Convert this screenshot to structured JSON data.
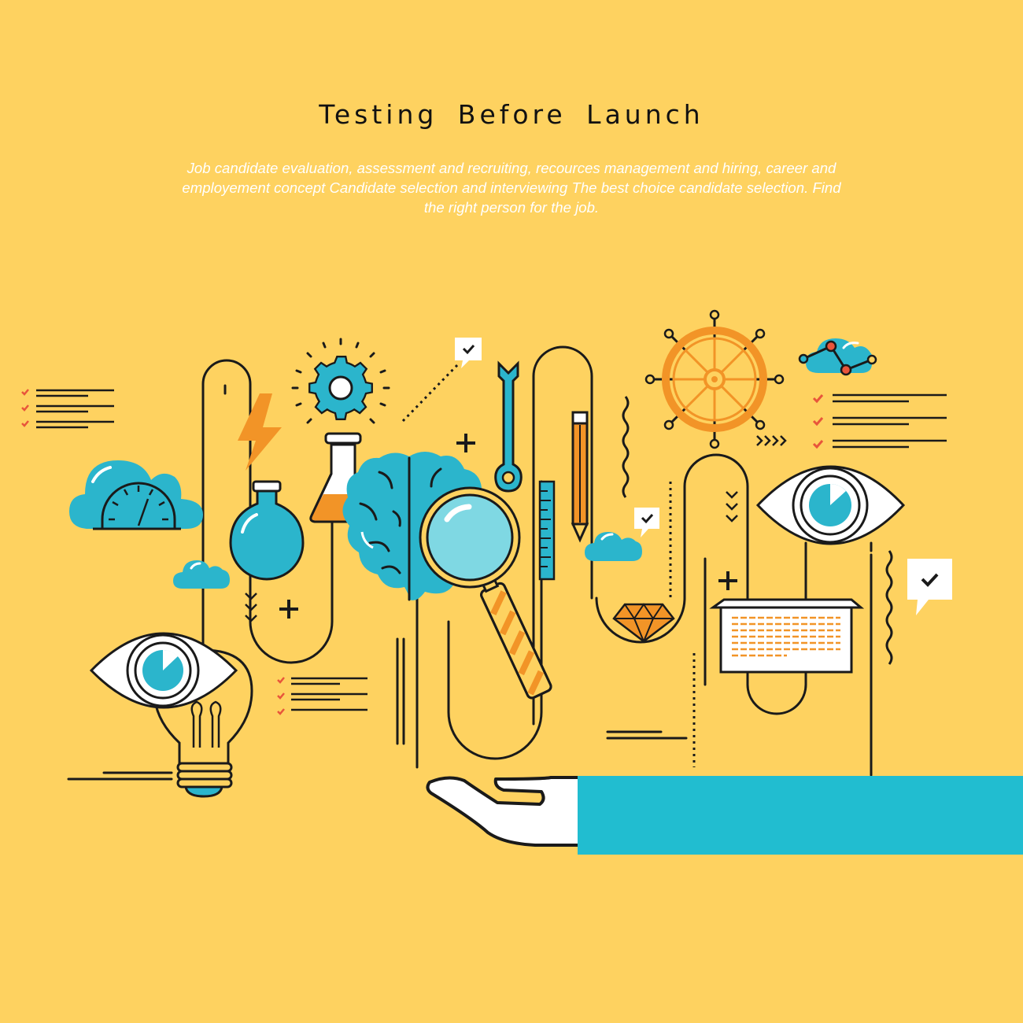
{
  "header": {
    "title": "Testing Before Launch",
    "subtitle": "Job candidate evaluation, assessment and recruiting, recources management and hiring, career and employement concept  Candidate selection and interviewing  The best choice candidate selection. Find the right person for the job."
  },
  "colors": {
    "background": "#fed260",
    "line": "#1a1a1a",
    "accent_blue": "#2bb5cc",
    "accent_orange": "#f29427",
    "check_red": "#e8553b",
    "panel_blue": "#21bdd0",
    "white": "#ffffff"
  },
  "illustration": {
    "icons": [
      "eye-icon",
      "lightbulb-icon",
      "speedometer-icon",
      "cloud-icon",
      "lightning-icon",
      "gear-icon",
      "flask-icon",
      "round-flask-icon",
      "brain-icon",
      "magnifier-icon",
      "wrench-icon",
      "pencil-icon",
      "ruler-icon",
      "ship-wheel-icon",
      "diamond-icon",
      "chat-check-icon",
      "checklist-icon",
      "hand-icon",
      "network-cloud-icon",
      "plus-icon",
      "chevrons-icon",
      "wavy-line-icon",
      "document-icon"
    ]
  }
}
